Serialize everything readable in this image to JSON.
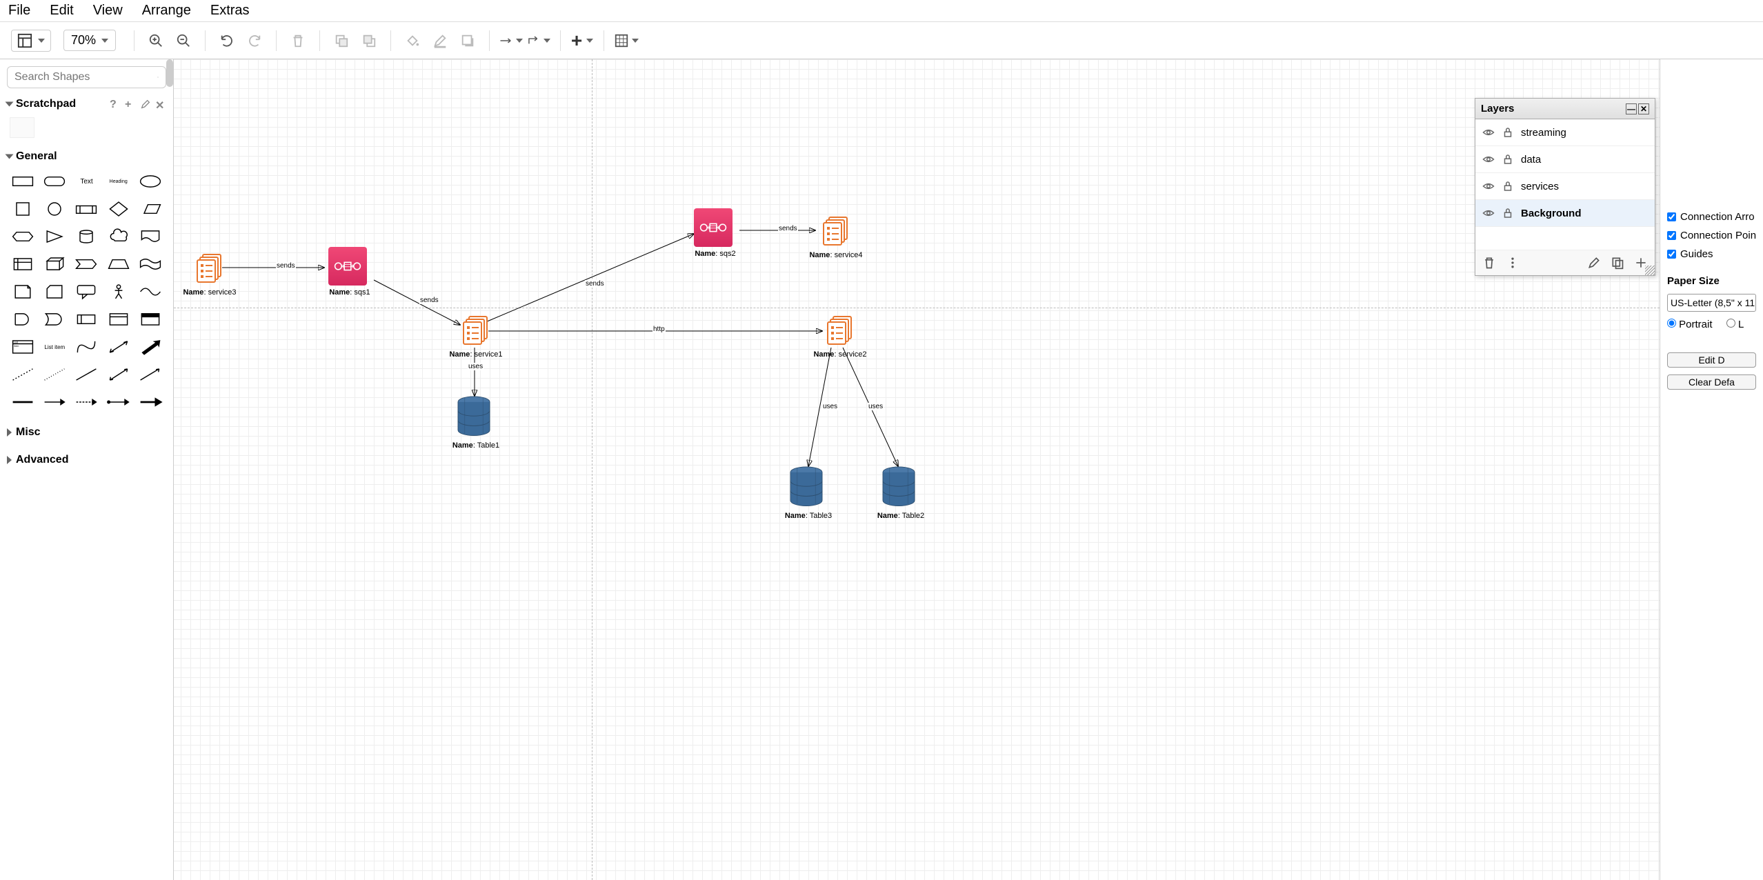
{
  "menu": {
    "file": "File",
    "edit": "Edit",
    "view": "View",
    "arrange": "Arrange",
    "extras": "Extras"
  },
  "toolbar": {
    "zoom": "70%"
  },
  "sidebar": {
    "search_placeholder": "Search Shapes",
    "scratchpad": "Scratchpad",
    "general": "General",
    "misc": "Misc",
    "advanced": "Advanced",
    "shape_text": "Text",
    "shape_heading": "Heading"
  },
  "layers": {
    "title": "Layers",
    "items": [
      {
        "name": "streaming",
        "selected": false
      },
      {
        "name": "data",
        "selected": false
      },
      {
        "name": "services",
        "selected": false
      },
      {
        "name": "Background",
        "selected": true
      }
    ]
  },
  "right": {
    "conn_arrows": "Connection Arro",
    "conn_points": "Connection Poin",
    "guides": "Guides",
    "paper_size_label": "Paper Size",
    "paper_size_value": "US-Letter (8,5\" x 11",
    "portrait": "Portrait",
    "landscape": "L",
    "edit_btn": "Edit D",
    "clear_btn": "Clear Defa"
  },
  "canvas": {
    "label_prefix": "Name",
    "nodes": {
      "service3": "service3",
      "sqs1": "sqs1",
      "service1": "service1",
      "table1": "Table1",
      "sqs2": "sqs2",
      "service4": "service4",
      "service2": "service2",
      "table3": "Table3",
      "table2": "Table2"
    },
    "edges": {
      "sends": "sends",
      "http": "http",
      "uses": "uses"
    }
  }
}
